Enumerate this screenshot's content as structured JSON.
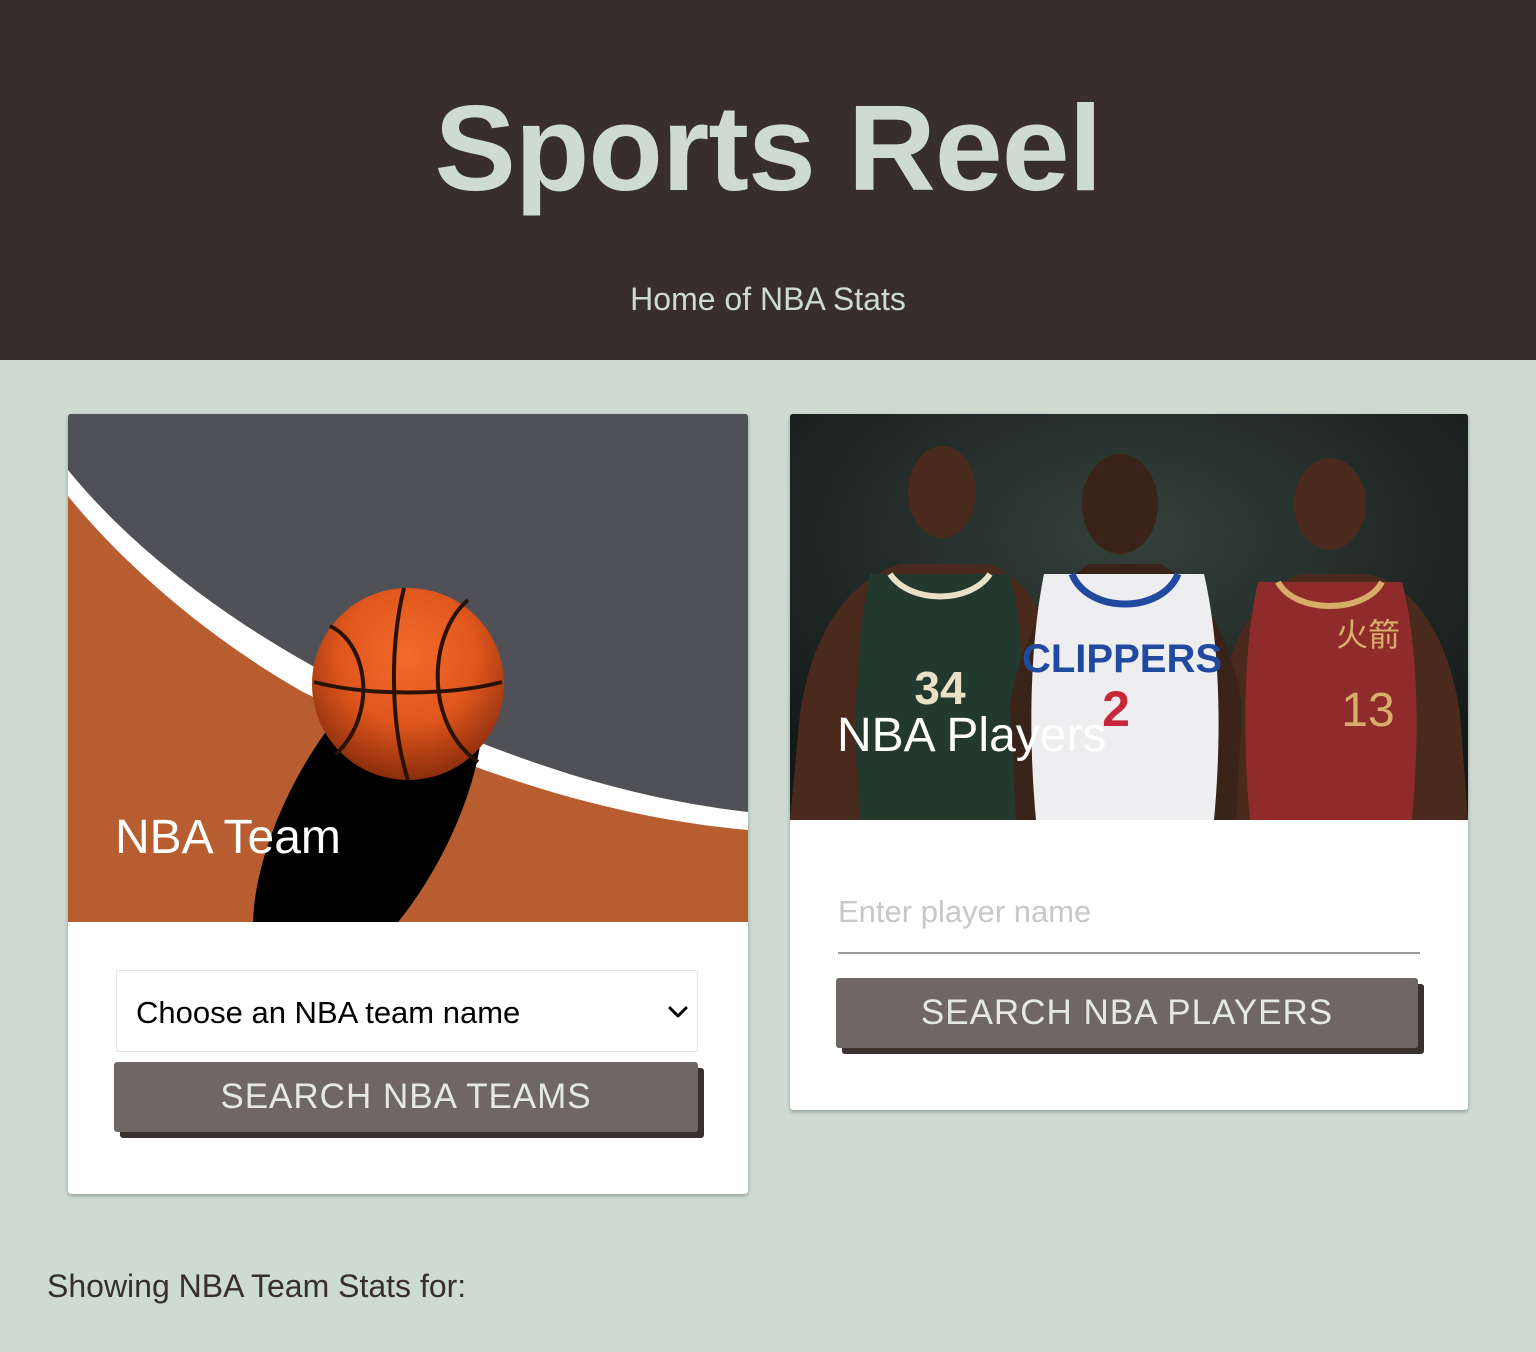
{
  "header": {
    "title": "Sports Reel",
    "subtitle": "Home of NBA Stats"
  },
  "colors": {
    "header_bg": "#372e2d",
    "page_bg": "#cddbd3",
    "accent_text": "#cddbd3",
    "button_bg": "#6f6765",
    "court_orange": "#b85d30",
    "court_gray": "#505157"
  },
  "team_card": {
    "title": "NBA Team",
    "image_icon": "basketball-court-icon",
    "select": {
      "value": "Choose an NBA team name",
      "icon": "chevron-down-icon"
    },
    "button_label": "SEARCH NBA TEAMS"
  },
  "players_card": {
    "title": "NBA Players",
    "image_icon": "nba-players-photo",
    "jerseys": {
      "left_number": "34",
      "middle_team": "CLIPPERS",
      "middle_number": "2",
      "right_team": "火箭",
      "right_number": "13"
    },
    "input": {
      "placeholder": "Enter player name"
    },
    "button_label": "SEARCH NBA PLAYERS"
  },
  "results": {
    "label": "Showing NBA Team Stats for:"
  }
}
